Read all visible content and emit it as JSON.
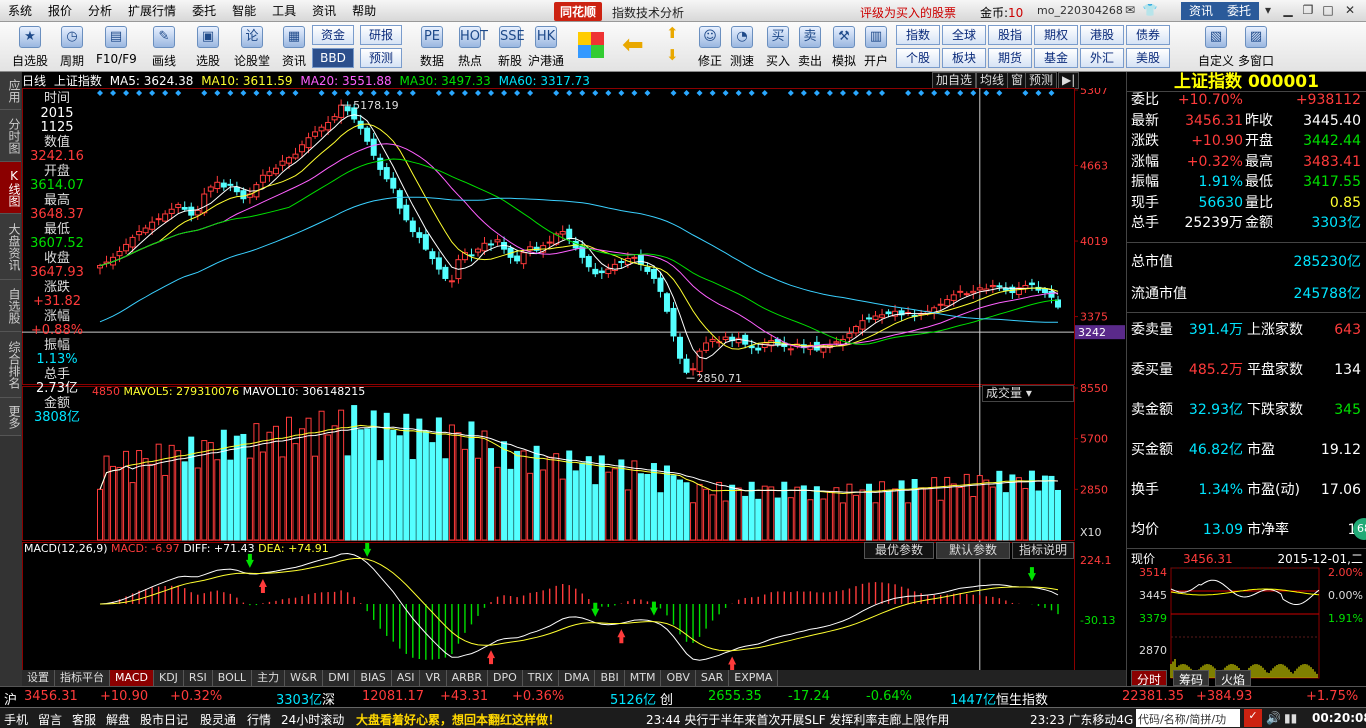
{
  "menu": {
    "items": [
      "系统",
      "报价",
      "分析",
      "扩展行情",
      "委托",
      "智能",
      "工具",
      "资讯",
      "帮助"
    ],
    "logo": "同花顺",
    "subtitle": "指数技术分析",
    "alert": "评级为买入的股票",
    "coin_label": "金币:",
    "coin_value": "10",
    "user": "mo_220304268",
    "btn_news": "资讯",
    "btn_trade": "委托"
  },
  "toolbar": {
    "buttons": [
      {
        "label": "自选股",
        "icon": "★"
      },
      {
        "label": "周期",
        "icon": "◷"
      },
      {
        "label": "F10/F9",
        "icon": "▤"
      },
      {
        "label": "画线",
        "icon": "✎"
      },
      {
        "label": "选股",
        "icon": "▣"
      },
      {
        "label": "论股堂",
        "icon": "论"
      },
      {
        "label": "资讯",
        "icon": "▦"
      }
    ],
    "small_a": [
      "资金",
      "BBD"
    ],
    "small_b": [
      "研报",
      "预测"
    ],
    "buttons2": [
      {
        "label": "数据",
        "icon": "PE"
      },
      {
        "label": "热点",
        "icon": "HOT"
      },
      {
        "label": "新股",
        "icon": "SSE"
      },
      {
        "label": "沪港通",
        "icon": "HK"
      }
    ],
    "buttons3": [
      {
        "label": "修正",
        "icon": "☺"
      },
      {
        "label": "测速",
        "icon": "◔"
      },
      {
        "label": "买入",
        "icon": "买"
      },
      {
        "label": "卖出",
        "icon": "卖"
      },
      {
        "label": "模拟",
        "icon": "⚒"
      },
      {
        "label": "开户",
        "icon": "▥"
      }
    ],
    "grid": [
      [
        "指数",
        "全球",
        "股指",
        "期权",
        "港股",
        "债券"
      ],
      [
        "个股",
        "板块",
        "期货",
        "基金",
        "外汇",
        "美股"
      ]
    ],
    "right_buttons": [
      {
        "label": "自定义",
        "icon": "▧"
      },
      {
        "label": "多窗口",
        "icon": "▨"
      }
    ]
  },
  "left_tabs": [
    "应用",
    "分时图",
    "K线图",
    "大盘资讯",
    "自选股",
    "综合排名",
    "更多"
  ],
  "chart_header": {
    "period": "日线",
    "name": "上证指数",
    "ma5": "MA5: 3624.38",
    "ma10": "MA10: 3611.59",
    "ma20": "MA20: 3551.88",
    "ma30": "MA30: 3497.33",
    "ma60": "MA60: 3317.73",
    "btns": [
      "加自选",
      "均线",
      "窗",
      "预测"
    ]
  },
  "kinfo": [
    {
      "label": "时间",
      "value": "2015",
      "cls": "white"
    },
    {
      "label": "",
      "value": "1125",
      "cls": "white"
    },
    {
      "label": "数值",
      "value": "3242.16",
      "cls": "red"
    },
    {
      "label": "开盘",
      "value": "3614.07",
      "cls": "green"
    },
    {
      "label": "最高",
      "value": "3648.37",
      "cls": "red"
    },
    {
      "label": "最低",
      "value": "3607.52",
      "cls": "green"
    },
    {
      "label": "收盘",
      "value": "3647.93",
      "cls": "red"
    },
    {
      "label": "涨跌",
      "value": "+31.82",
      "cls": "red"
    },
    {
      "label": "涨幅",
      "value": "+0.88%",
      "cls": "red"
    },
    {
      "label": "振幅",
      "value": "1.13%",
      "cls": "cyan"
    },
    {
      "label": "总手",
      "value": "2.73亿",
      "cls": "white"
    },
    {
      "label": "金额",
      "value": "3808亿",
      "cls": "cyan"
    }
  ],
  "price_axis": [
    "5307",
    "4663",
    "4019",
    "3375"
  ],
  "cursor_price": "3242",
  "peak_label": "5178.19",
  "trough_label": "2850.71",
  "vol_header": {
    "vol": "4850",
    "mavol5": "MAVOL5: 279310076",
    "mavol10": "MAVOL10: 306148215",
    "dropdown": "成交量"
  },
  "vol_axis": [
    "8550",
    "5700",
    "2850",
    "X10"
  ],
  "macd_header": {
    "name": "MACD(12,26,9)",
    "macd": "MACD: -6.97",
    "diff": "DIFF: +71.43",
    "dea": "DEA: +74.91",
    "btns": [
      "最优参数",
      "默认参数",
      "指标说明"
    ]
  },
  "macd_axis": [
    "224.1",
    "-30.13"
  ],
  "month_labels": [
    "04",
    "05",
    "06",
    "07",
    "08",
    "09",
    "10",
    "11"
  ],
  "cursor_date": "2015-11-25,三",
  "bottom_tabs": [
    "设置",
    "指标平台",
    "MACD",
    "KDJ",
    "RSI",
    "BOLL",
    "主力",
    "W&R",
    "DMI",
    "BIAS",
    "ASI",
    "VR",
    "ARBR",
    "DPO",
    "TRIX",
    "DMA",
    "BBI",
    "MTM",
    "OBV",
    "SAR",
    "EXPMA"
  ],
  "right_panel": {
    "title": "上证指数 000001",
    "rows": [
      {
        "l": "委比",
        "v1": "+10.70%",
        "c1": "red",
        "l2": "",
        "v2": "+938112",
        "c2": "red"
      },
      {
        "l": "最新",
        "v1": "3456.31",
        "c1": "red",
        "l2": "昨收",
        "v2": "3445.40",
        "c2": "white"
      },
      {
        "l": "涨跌",
        "v1": "+10.90",
        "c1": "red",
        "l2": "开盘",
        "v2": "3442.44",
        "c2": "green"
      },
      {
        "l": "涨幅",
        "v1": "+0.32%",
        "c1": "red",
        "l2": "最高",
        "v2": "3483.41",
        "c2": "red"
      },
      {
        "l": "振幅",
        "v1": "1.91%",
        "c1": "cyan",
        "l2": "最低",
        "v2": "3417.55",
        "c2": "green"
      },
      {
        "l": "现手",
        "v1": "56630",
        "c1": "cyan",
        "l2": "量比",
        "v2": "0.85",
        "c2": "yellow"
      },
      {
        "l": "总手",
        "v1": "25239万",
        "c1": "white",
        "l2": "金额",
        "v2": "3303亿",
        "c2": "cyan"
      }
    ],
    "cap": [
      {
        "l": "总市值",
        "v": "285230亿",
        "c": "cyan"
      },
      {
        "l": "流通市值",
        "v": "245788亿",
        "c": "cyan"
      }
    ],
    "stats": [
      {
        "l": "委卖量",
        "v1": "391.4万",
        "c1": "cyan",
        "l2": "上涨家数",
        "v2": "643",
        "c2": "red"
      },
      {
        "l": "委买量",
        "v1": "485.2万",
        "c1": "red",
        "l2": "平盘家数",
        "v2": "134",
        "c2": "white"
      },
      {
        "l": "卖金额",
        "v1": "32.93亿",
        "c1": "cyan",
        "l2": "下跌家数",
        "v2": "345",
        "c2": "green"
      },
      {
        "l": "买金额",
        "v1": "46.82亿",
        "c1": "cyan",
        "l2": "市盈",
        "v2": "19.12",
        "c2": "white"
      },
      {
        "l": "换手",
        "v1": "1.34%",
        "c1": "cyan",
        "l2": "市盈(动)",
        "v2": "17.06",
        "c2": "white"
      },
      {
        "l": "均价",
        "v1": "13.09",
        "c1": "cyan",
        "l2": "市净率",
        "v2": "1.",
        "c2": "white"
      }
    ],
    "badge": "68",
    "mini": {
      "label": "现价",
      "price": "3456.31",
      "date": "2015-12-01,二",
      "y_labels": [
        "3514",
        "3445",
        "3379",
        "2870",
        "X1000"
      ],
      "pct_labels": [
        "2.00%",
        "0.00%",
        "1.91%"
      ],
      "tabs": [
        "分时",
        "筹码",
        "火焰"
      ]
    }
  },
  "status": {
    "sh": "沪",
    "sh_price": "3456.31",
    "sh_chg": "+10.90",
    "sh_pct": "+0.32%",
    "sh_amt": "3303亿",
    "sz": "深",
    "sz_price": "12081.17",
    "sz_chg": "+43.31",
    "sz_pct": "+0.36%",
    "sz_amt": "5126亿",
    "cy": "创",
    "cy_price": "2655.35",
    "cy_chg": "-17.24",
    "cy_pct": "-0.64%",
    "cy_amt": "1447亿",
    "hs": "恒生指数",
    "hs_price": "22381.35",
    "hs_chg": "+384.93",
    "hs_pct": "+1.75%"
  },
  "taskbar": {
    "items": [
      "手机",
      "留言",
      "客服",
      "解盘",
      "股市日记",
      "股灵通",
      "行情",
      "24小时滚动"
    ],
    "news1": "大盘看着好心累，想回本翻红这样做！",
    "news2": "23:44 央行于半年来首次开展SLF 发挥利率走廊上限作用",
    "news3": "23:23 广东移动4G",
    "search": "代码/名称/简拼/功",
    "time": "00:20:08"
  },
  "chart_data": [
    {
      "type": "candlestick",
      "title": "上证指数 日线",
      "x_range": [
        "2015-04",
        "2015-12-01"
      ],
      "ylim": [
        2850,
        5307
      ],
      "x_months": [
        "04",
        "05",
        "06",
        "07",
        "08",
        "09",
        "10",
        "11"
      ],
      "close_series": [
        3810,
        3840,
        3880,
        3930,
        3990,
        4050,
        4100,
        4130,
        4180,
        4210,
        4250,
        4290,
        4330,
        4290,
        4240,
        4280,
        4420,
        4480,
        4520,
        4480,
        4500,
        4440,
        4380,
        4420,
        4500,
        4580,
        4610,
        4640,
        4700,
        4730,
        4760,
        4840,
        4900,
        4950,
        4990,
        5030,
        5080,
        5178,
        5130,
        5060,
        4980,
        4870,
        4750,
        4630,
        4550,
        4470,
        4300,
        4200,
        4100,
        4050,
        3950,
        3870,
        3780,
        3700,
        3680,
        3860,
        3920,
        3900,
        3950,
        4000,
        3990,
        4030,
        3950,
        3880,
        3850,
        3920,
        3970,
        3940,
        3980,
        4010,
        4080,
        4100,
        4040,
        3960,
        3880,
        3800,
        3740,
        3750,
        3780,
        3820,
        3840,
        3870,
        3880,
        3820,
        3760,
        3700,
        3590,
        3420,
        3210,
        3020,
        2900,
        2930,
        3080,
        3150,
        3180,
        3160,
        3200,
        3170,
        3190,
        3140,
        3110,
        3090,
        3150,
        3170,
        3140,
        3120,
        3100,
        3140,
        3110,
        3130,
        3090,
        3110,
        3130,
        3160,
        3180,
        3230,
        3290,
        3340,
        3360,
        3380,
        3390,
        3400,
        3420,
        3390,
        3410,
        3380,
        3400,
        3420,
        3450,
        3480,
        3520,
        3560,
        3590,
        3570,
        3590,
        3620,
        3610,
        3640,
        3630,
        3600,
        3580,
        3620,
        3640,
        3648,
        3600,
        3580,
        3540,
        3456
      ],
      "ma5_last": 3624.38,
      "ma10_last": 3611.59,
      "ma20_last": 3551.88,
      "ma30_last": 3497.33,
      "ma60_last": 3317.73,
      "peak": 5178.19,
      "trough": 2850.71
    },
    {
      "type": "bar",
      "title": "成交量",
      "ylim": [
        0,
        8550
      ],
      "unit": "X10",
      "mavol5": 279310076,
      "mavol10": 306148215
    },
    {
      "type": "bar",
      "title": "MACD(12,26,9)",
      "ylim": [
        -224.1,
        224.1
      ],
      "macd_last": -6.97,
      "diff_last": 71.43,
      "dea_last": 74.91
    }
  ]
}
